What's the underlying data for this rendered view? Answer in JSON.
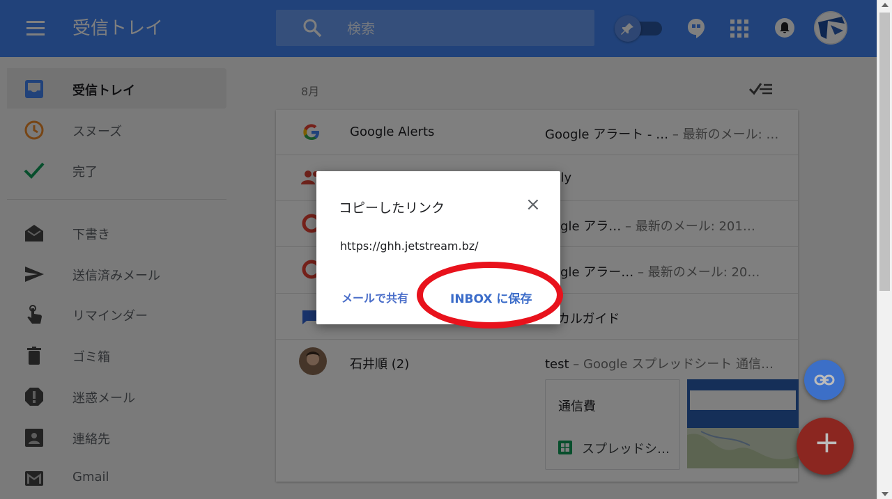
{
  "header": {
    "title": "受信トレイ",
    "search_placeholder": "検索"
  },
  "sidebar": {
    "items": [
      {
        "label": "受信トレイ",
        "icon": "inbox-icon"
      },
      {
        "label": "スヌーズ",
        "icon": "clock-icon"
      },
      {
        "label": "完了",
        "icon": "check-icon"
      },
      {
        "label": "下書き",
        "icon": "drafts-icon"
      },
      {
        "label": "送信済みメール",
        "icon": "send-icon"
      },
      {
        "label": "リマインダー",
        "icon": "reminder-icon"
      },
      {
        "label": "ゴミ箱",
        "icon": "trash-icon"
      },
      {
        "label": "迷惑メール",
        "icon": "spam-icon"
      },
      {
        "label": "連絡先",
        "icon": "contacts-icon"
      },
      {
        "label": "Gmail",
        "icon": "gmail-icon"
      }
    ]
  },
  "main": {
    "section_date": "8月",
    "rows": [
      {
        "sender": "Google Alerts",
        "subject": "Google アラート - …",
        "snippet": " – 最新のメール: …"
      },
      {
        "sender": "",
        "subject": "edly",
        "snippet": ""
      },
      {
        "sender": "",
        "subject": "oogle アラ…",
        "snippet": "   – 最新のメール: 201…"
      },
      {
        "sender": "",
        "subject": "oogle アラー…",
        "snippet": "  – 最新のメール: 20…"
      },
      {
        "sender": "",
        "subject": "ーカルガイド",
        "snippet": ""
      },
      {
        "sender": "石井順 (2)",
        "subject": "test",
        "snippet": " – Google スプレッドシート 通信…"
      }
    ],
    "attachment": {
      "title": "通信費",
      "label": "スプレッドシ…"
    }
  },
  "dialog": {
    "title": "コピーしたリンク",
    "close": "×",
    "url": "https://ghh.jetstream.bz/",
    "share_label": "メールで共有",
    "save_label": "INBOX に保存"
  },
  "colors": {
    "accent": "#4285f4",
    "highlight": "#e8121c",
    "link": "#3b6cc9"
  }
}
